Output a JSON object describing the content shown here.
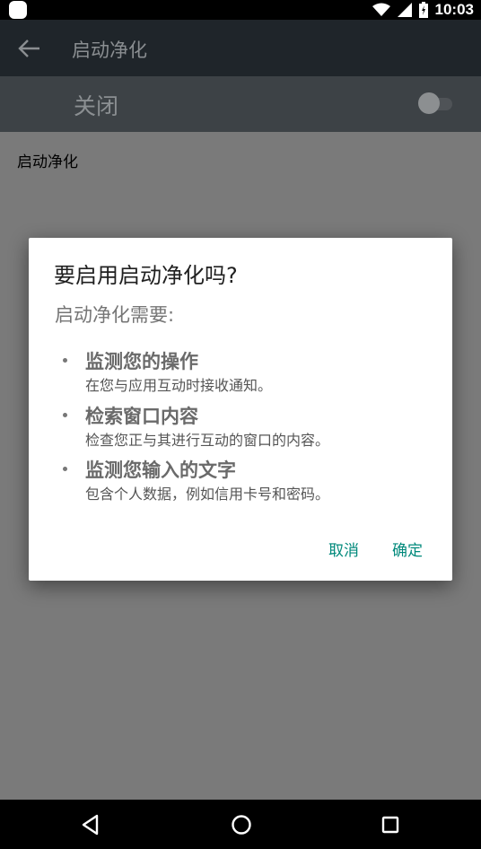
{
  "status_bar": {
    "time": "10:03",
    "icons": [
      "app-notification-icon",
      "wifi-icon",
      "signal-icon",
      "battery-icon"
    ]
  },
  "app_bar": {
    "title": "启动净化",
    "back_icon": "arrow-back-icon"
  },
  "toggle_row": {
    "label": "关闭",
    "switch_on": false
  },
  "main": {
    "section_label": "启动净化"
  },
  "dialog": {
    "title": "要启用启动净化吗?",
    "intro": "启动净化需要:",
    "permissions": [
      {
        "title": "监测您的操作",
        "description": "在您与应用互动时接收通知。"
      },
      {
        "title": "检索窗口内容",
        "description": "检查您正与其进行互动的窗口的内容。"
      },
      {
        "title": "监测您输入的文字",
        "description": "包含个人数据，例如信用卡号和密码。"
      }
    ],
    "cancel_label": "取消",
    "ok_label": "确定"
  },
  "nav_bar": {
    "icons": [
      "nav-back-icon",
      "nav-home-icon",
      "nav-recents-icon"
    ]
  },
  "colors": {
    "accent": "#00897b",
    "scrim_background": "#7a7a7a",
    "dialog_background": "#ffffff"
  }
}
